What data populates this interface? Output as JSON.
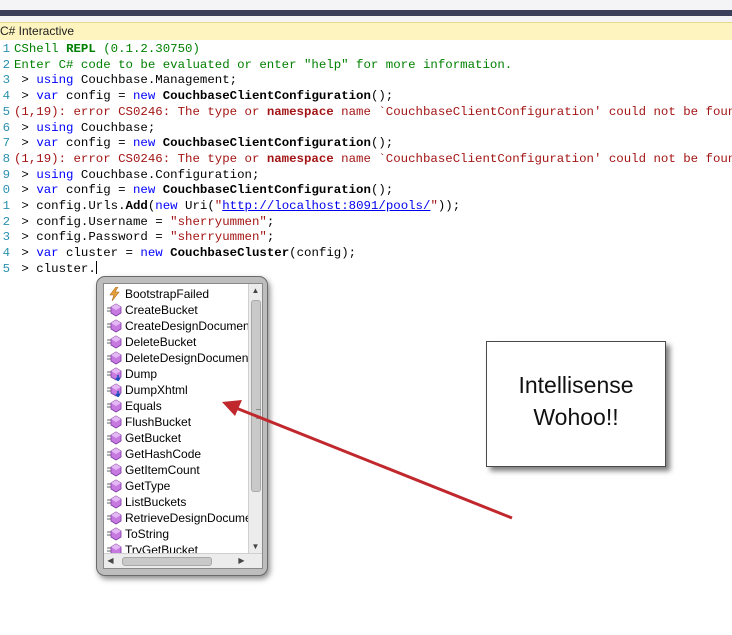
{
  "window": {
    "tab_title": "C# Interactive"
  },
  "editor": {
    "lines": [
      {
        "n": "1",
        "segs": [
          {
            "t": "CShell ",
            "c": "green"
          },
          {
            "t": "REPL",
            "c": "green bold"
          },
          {
            "t": " (0.1.2.30750)",
            "c": "green"
          }
        ]
      },
      {
        "n": "2",
        "segs": [
          {
            "t": "Enter C# code to be evaluated or enter \"help\" for more information.",
            "c": "green"
          }
        ]
      },
      {
        "n": "3",
        "segs": [
          {
            "t": " > ",
            "c": "black"
          },
          {
            "t": "using",
            "c": "kw"
          },
          {
            "t": " Couchbase.Management;",
            "c": "black"
          }
        ]
      },
      {
        "n": "4",
        "segs": [
          {
            "t": " > ",
            "c": "black"
          },
          {
            "t": "var",
            "c": "kw"
          },
          {
            "t": " config = ",
            "c": "black"
          },
          {
            "t": "new",
            "c": "kw"
          },
          {
            "t": " ",
            "c": "black"
          },
          {
            "t": "CouchbaseClientConfiguration",
            "c": "bold"
          },
          {
            "t": "();",
            "c": "black"
          }
        ]
      },
      {
        "n": "5",
        "segs": [
          {
            "t": "(1,19): error CS0246: The type or ",
            "c": "red"
          },
          {
            "t": "namespace",
            "c": "red bold"
          },
          {
            "t": " name `CouchbaseClientConfiguration' could not be found.",
            "c": "red"
          }
        ]
      },
      {
        "n": "6",
        "segs": [
          {
            "t": " > ",
            "c": "black"
          },
          {
            "t": "using",
            "c": "kw"
          },
          {
            "t": " Couchbase;",
            "c": "black"
          }
        ]
      },
      {
        "n": "7",
        "segs": [
          {
            "t": " > ",
            "c": "black"
          },
          {
            "t": "var",
            "c": "kw"
          },
          {
            "t": " config = ",
            "c": "black"
          },
          {
            "t": "new",
            "c": "kw"
          },
          {
            "t": " ",
            "c": "black"
          },
          {
            "t": "CouchbaseClientConfiguration",
            "c": "bold"
          },
          {
            "t": "();",
            "c": "black"
          }
        ]
      },
      {
        "n": "8",
        "segs": [
          {
            "t": "(1,19): error CS0246: The type or ",
            "c": "red"
          },
          {
            "t": "namespace",
            "c": "red bold"
          },
          {
            "t": " name `CouchbaseClientConfiguration' could not be found.",
            "c": "red"
          }
        ]
      },
      {
        "n": "9",
        "segs": [
          {
            "t": " > ",
            "c": "black"
          },
          {
            "t": "using",
            "c": "kw"
          },
          {
            "t": " Couchbase.Configuration;",
            "c": "black"
          }
        ]
      },
      {
        "n": "0",
        "segs": [
          {
            "t": " > ",
            "c": "black"
          },
          {
            "t": "var",
            "c": "kw"
          },
          {
            "t": " config = ",
            "c": "black"
          },
          {
            "t": "new",
            "c": "kw"
          },
          {
            "t": " ",
            "c": "black"
          },
          {
            "t": "CouchbaseClientConfiguration",
            "c": "bold"
          },
          {
            "t": "();",
            "c": "black"
          }
        ]
      },
      {
        "n": "1",
        "segs": [
          {
            "t": " > config.Urls.",
            "c": "black"
          },
          {
            "t": "Add",
            "c": "bold"
          },
          {
            "t": "(",
            "c": "black"
          },
          {
            "t": "new",
            "c": "kw"
          },
          {
            "t": " Uri(",
            "c": "black"
          },
          {
            "t": "\"",
            "c": "str"
          },
          {
            "t": "http://localhost:8091/pools/",
            "c": "url"
          },
          {
            "t": "\"",
            "c": "str"
          },
          {
            "t": "));",
            "c": "black"
          }
        ]
      },
      {
        "n": "2",
        "segs": [
          {
            "t": " > config.Username = ",
            "c": "black"
          },
          {
            "t": "\"sherryummen\"",
            "c": "str"
          },
          {
            "t": ";",
            "c": "black"
          }
        ]
      },
      {
        "n": "3",
        "segs": [
          {
            "t": " > config.Password = ",
            "c": "black"
          },
          {
            "t": "\"sherryummen\"",
            "c": "str"
          },
          {
            "t": ";",
            "c": "black"
          }
        ]
      },
      {
        "n": "4",
        "segs": [
          {
            "t": " > ",
            "c": "black"
          },
          {
            "t": "var",
            "c": "kw"
          },
          {
            "t": " cluster = ",
            "c": "black"
          },
          {
            "t": "new",
            "c": "kw"
          },
          {
            "t": " ",
            "c": "black"
          },
          {
            "t": "CouchbaseCluster",
            "c": "bold"
          },
          {
            "t": "(config);",
            "c": "black"
          }
        ]
      },
      {
        "n": "5",
        "segs": [
          {
            "t": " > cluster.",
            "c": "black"
          }
        ],
        "caret": true
      }
    ]
  },
  "intellisense": {
    "items": [
      {
        "label": "BootstrapFailed",
        "icon": "event-icon"
      },
      {
        "label": "CreateBucket",
        "icon": "method-icon"
      },
      {
        "label": "CreateDesignDocument",
        "icon": "method-icon"
      },
      {
        "label": "DeleteBucket",
        "icon": "method-icon"
      },
      {
        "label": "DeleteDesignDocument",
        "icon": "method-icon"
      },
      {
        "label": "Dump",
        "icon": "extension-method-icon"
      },
      {
        "label": "DumpXhtml",
        "icon": "extension-method-icon"
      },
      {
        "label": "Equals",
        "icon": "method-icon"
      },
      {
        "label": "FlushBucket",
        "icon": "method-icon"
      },
      {
        "label": "GetBucket",
        "icon": "method-icon"
      },
      {
        "label": "GetHashCode",
        "icon": "method-icon"
      },
      {
        "label": "GetItemCount",
        "icon": "method-icon"
      },
      {
        "label": "GetType",
        "icon": "method-icon"
      },
      {
        "label": "ListBuckets",
        "icon": "method-icon"
      },
      {
        "label": "RetrieveDesignDocument",
        "icon": "method-icon"
      },
      {
        "label": "ToString",
        "icon": "method-icon"
      },
      {
        "label": "TryGetBucket",
        "icon": "method-icon"
      }
    ]
  },
  "callout": {
    "line1": "Intellisense",
    "line2": "Wohoo!!"
  },
  "colors": {
    "arrow": "#c0282d",
    "tab_background": "#fdf4bf",
    "titlebar_stripe": "#3a3f5c"
  }
}
